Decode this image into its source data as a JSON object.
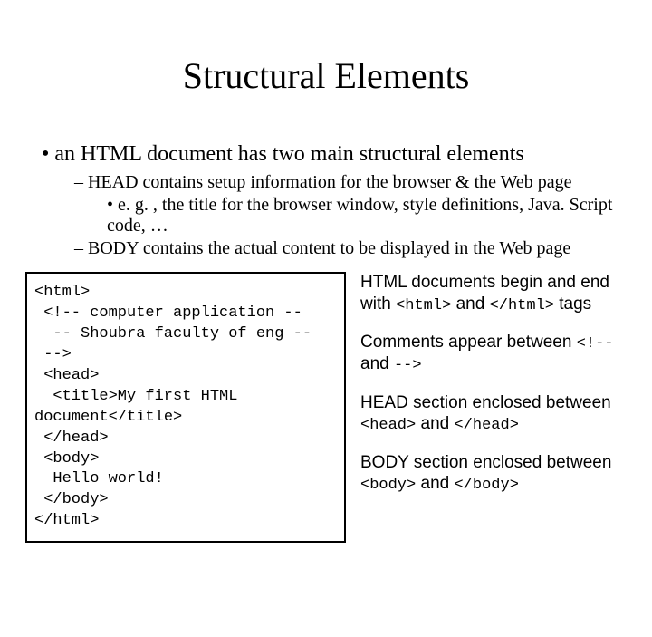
{
  "title": "Structural Elements",
  "bullets": {
    "l1": "an HTML document has two main structural elements",
    "l2a": "HEAD contains setup information for the browser & the Web page",
    "l3a": "e. g. , the title for the browser window, style definitions, Java. Script code, …",
    "l2b": "BODY contains the actual content to be displayed in the Web page"
  },
  "code": {
    "line1": "<html>",
    "line2": "<!-- computer application --",
    "line3": "-- Shoubra faculty of eng --",
    "line4": "-->",
    "line5": "<head>",
    "line6": "<title>My first HTML",
    "line7": "document</title>",
    "line8": "</head>",
    "line9": "<body>",
    "line10": "Hello world!",
    "line11": "</body>",
    "line12": "</html>"
  },
  "notes": {
    "p1a": "HTML documents begin and end with ",
    "p1c1": "<html>",
    "p1b": " and ",
    "p1c2": "</html>",
    "p1c": " tags",
    "p2a": "Comments appear between ",
    "p2c1": "<!--",
    "p2b": " and ",
    "p2c2": "-->",
    "p3a": "HEAD section enclosed between ",
    "p3c1": "<head>",
    "p3b": " and ",
    "p3c2": "</head>",
    "p4a": "BODY section enclosed between ",
    "p4c1": "<body>",
    "p4b": " and ",
    "p4c2": "</body>"
  }
}
